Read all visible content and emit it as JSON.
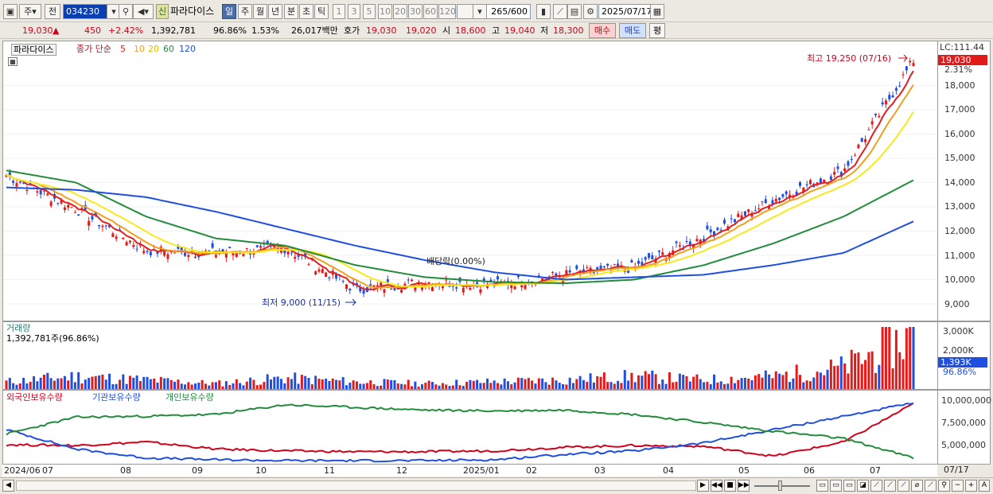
{
  "toolbar": {
    "type_select": "주",
    "prev_label": "전",
    "stock_code": "034230",
    "new_badge": "신",
    "stock_name": "파라다이스",
    "periods": [
      "일",
      "주",
      "월",
      "년",
      "분",
      "초",
      "틱"
    ],
    "active_period": "일",
    "intervals": [
      "1",
      "3",
      "5",
      "10",
      "20",
      "30",
      "60",
      "120"
    ],
    "count_value": "265",
    "count_total": "/600",
    "date_value": "2025/07/17"
  },
  "quote": {
    "price": "19,030",
    "change": "450",
    "change_pct": "+2.42%",
    "volume": "1,392,781",
    "volume_ratio": "96.86%",
    "turnover": "1.53%",
    "amount": "26,017백만",
    "ask_label": "호가",
    "ask1": "19,030",
    "ask2": "19,020",
    "low_label": "시",
    "open": "18,600",
    "high_label": "고",
    "high": "19,040",
    "low2_label": "저",
    "low": "18,300",
    "buy_label": "매수",
    "sell_label": "매도",
    "avg_label": "평"
  },
  "price_pane": {
    "stock_label": "파라다이스",
    "ma_title": "종가 단순",
    "ma_periods": [
      "5",
      "10",
      "20",
      "60",
      "120"
    ],
    "ma_colors": [
      "#e02020",
      "#f0a020",
      "#f8e81c",
      "#228b3c",
      "#1f4fe0"
    ],
    "lc_label": "LC:111.44",
    "current_tag": "19,030",
    "current_pct": "2.31%",
    "max_label": "최고 19,250 (07/16)",
    "min_label": "최저 9,000 (11/15)",
    "dividend_label": "배당락(0.00%)",
    "yticks": [
      "18,000",
      "17,000",
      "16,000",
      "15,000",
      "14,000",
      "13,000",
      "12,000",
      "11,000",
      "10,000",
      "9,000"
    ]
  },
  "volume_pane": {
    "title": "거래량",
    "value_label": "1,392,781주(96.86%)",
    "yticks": [
      "3,000K",
      "2,000K",
      "1,000K"
    ],
    "current_tag": "1,393K",
    "current_pct": "96.86%"
  },
  "holding_pane": {
    "legend": [
      "외국인보유수량",
      "기관보유수량",
      "개인보유수량"
    ],
    "legend_colors": [
      "#d0021b",
      "#1f4fe0",
      "#228b3c"
    ],
    "yticks": [
      "10,000,000",
      "7,500,000",
      "5,000,000"
    ]
  },
  "xaxis": {
    "labels": [
      "2024/06",
      "07",
      "08",
      "09",
      "10",
      "11",
      "12",
      "2025/01",
      "02",
      "03",
      "04",
      "05",
      "06",
      "07"
    ],
    "end_label": "07/17"
  },
  "chart_data": {
    "type": "line",
    "title": "",
    "series": [
      {
        "name": "종가",
        "x": [
          "2024/06",
          "2024/07",
          "2024/08",
          "2024/09",
          "2024/10",
          "2024/11",
          "2024/12",
          "2025/01",
          "2025/02",
          "2025/03",
          "2025/04",
          "2025/05",
          "2025/06",
          "2025/07"
        ],
        "values": [
          14300,
          12900,
          11200,
          11100,
          11300,
          9600,
          9900,
          9800,
          10200,
          10500,
          11800,
          13300,
          14500,
          19030
        ]
      },
      {
        "name": "120",
        "values": [
          13800,
          13700,
          13400,
          12800,
          12100,
          11400,
          10800,
          10300,
          10000,
          10100,
          10200,
          10600,
          11100,
          12400
        ]
      },
      {
        "name": "60",
        "values": [
          14500,
          14000,
          12600,
          11700,
          11400,
          10600,
          10100,
          9900,
          9850,
          10000,
          10600,
          11500,
          12600,
          14100
        ]
      }
    ],
    "volume_k": [
      400,
      700,
      500,
      300,
      600,
      400,
      300,
      400,
      500,
      700,
      500,
      700,
      1200,
      3000
    ],
    "ylim": [
      8500,
      19500
    ]
  }
}
